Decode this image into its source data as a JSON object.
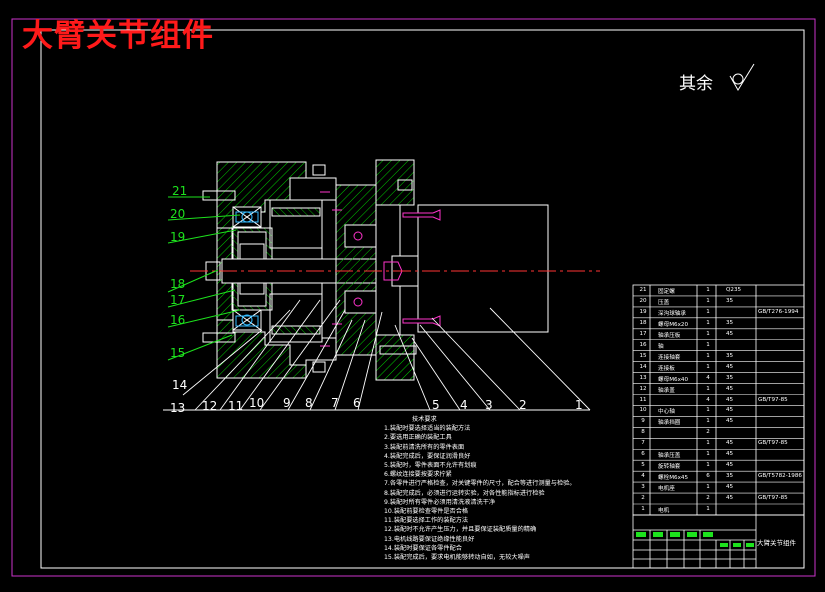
{
  "title": "大臂关节组件",
  "roughness": {
    "label": "其余",
    "icon": "surface-roughness-icon"
  },
  "tech_requirements": {
    "heading": "技术要求",
    "items": [
      "1.装配时要选择适当的装配方法",
      "2.要选用正确的装配工具",
      "3.装配前清洗所有的零件表面",
      "4.装配完成后，要保证润滑良好",
      "5.装配时，零件表面不允许有划痕",
      "6.螺纹连接要按要求拧紧",
      "7.各零件进行严格检查，对关键零件的尺寸，配合等进行测量与检验。",
      "8.装配完成后，必须进行运转实验，对各性能指标进行检验",
      "9.装配时所有零件必须用清洗液清洗干净",
      "10.装配前要检查零件是否合格",
      "11.装配要选择工作的装配方法",
      "12.装配时不允许产生压力，并且要保证装配质量的精确",
      "13.电机线路要保证绝缘性能良好",
      "14.装配时要保证各零件配合",
      "15.装配完成后，要求电机能够转动自如，无较大噪声"
    ]
  },
  "callouts": {
    "left": [
      "21",
      "20",
      "19",
      "18",
      "17",
      "16",
      "15"
    ],
    "bottom": [
      "14",
      "13",
      "12",
      "11",
      "10",
      "9",
      "8",
      "7",
      "6",
      "5",
      "4",
      "3",
      "2",
      "1"
    ]
  },
  "bom": [
    {
      "no": "21",
      "name": "固定螺",
      "qty": "1",
      "mat": "Q235",
      "std": ""
    },
    {
      "no": "20",
      "name": "压盖",
      "qty": "1",
      "mat": "35",
      "std": ""
    },
    {
      "no": "19",
      "name": "深沟球轴承",
      "qty": "1",
      "mat": "",
      "std": "GB/T276-1994"
    },
    {
      "no": "18",
      "name": "螺母M6x20",
      "qty": "1",
      "mat": "35",
      "std": ""
    },
    {
      "no": "17",
      "name": "轴承压板",
      "qty": "1",
      "mat": "45",
      "std": ""
    },
    {
      "no": "16",
      "name": "轴",
      "qty": "1",
      "mat": "",
      "std": ""
    },
    {
      "no": "15",
      "name": "连接轴套",
      "qty": "1",
      "mat": "35",
      "std": ""
    },
    {
      "no": "14",
      "name": "连接板",
      "qty": "1",
      "mat": "45",
      "std": ""
    },
    {
      "no": "13",
      "name": "螺母M6x40",
      "qty": "4",
      "mat": "35",
      "std": ""
    },
    {
      "no": "12",
      "name": "轴承盖",
      "qty": "1",
      "mat": "45",
      "std": ""
    },
    {
      "no": "11",
      "name": "",
      "qty": "4",
      "mat": "45",
      "std": "GB/T97-85"
    },
    {
      "no": "10",
      "name": "中心轴",
      "qty": "1",
      "mat": "45",
      "std": ""
    },
    {
      "no": "9",
      "name": "轴承挡圈",
      "qty": "1",
      "mat": "45",
      "std": ""
    },
    {
      "no": "8",
      "name": "",
      "qty": "2",
      "mat": "",
      "std": ""
    },
    {
      "no": "7",
      "name": "",
      "qty": "1",
      "mat": "45",
      "std": "GB/T97-85"
    },
    {
      "no": "6",
      "name": "轴承压盖",
      "qty": "1",
      "mat": "45",
      "std": ""
    },
    {
      "no": "5",
      "name": "旋转轴套",
      "qty": "1",
      "mat": "45",
      "std": ""
    },
    {
      "no": "4",
      "name": "螺栓M6x45",
      "qty": "6",
      "mat": "35",
      "std": "GB/T5782-1986"
    },
    {
      "no": "3",
      "name": "电机座",
      "qty": "1",
      "mat": "45",
      "std": ""
    },
    {
      "no": "2",
      "name": "",
      "qty": "2",
      "mat": "45",
      "std": "GB/T97-85"
    },
    {
      "no": "1",
      "name": "电机",
      "qty": "1",
      "mat": "",
      "std": ""
    }
  ],
  "titleblock": {
    "drawing_title": "大臂关节组件"
  },
  "colors": {
    "outline": "#ffffff",
    "frame": "#cc33cc",
    "hatch": "#00cc00",
    "leader_green": "#1de21d",
    "bolt": "#ff33cc",
    "centerline": "#ff3333",
    "title": "#ff1a1a",
    "section_cyan": "#33bbff"
  }
}
